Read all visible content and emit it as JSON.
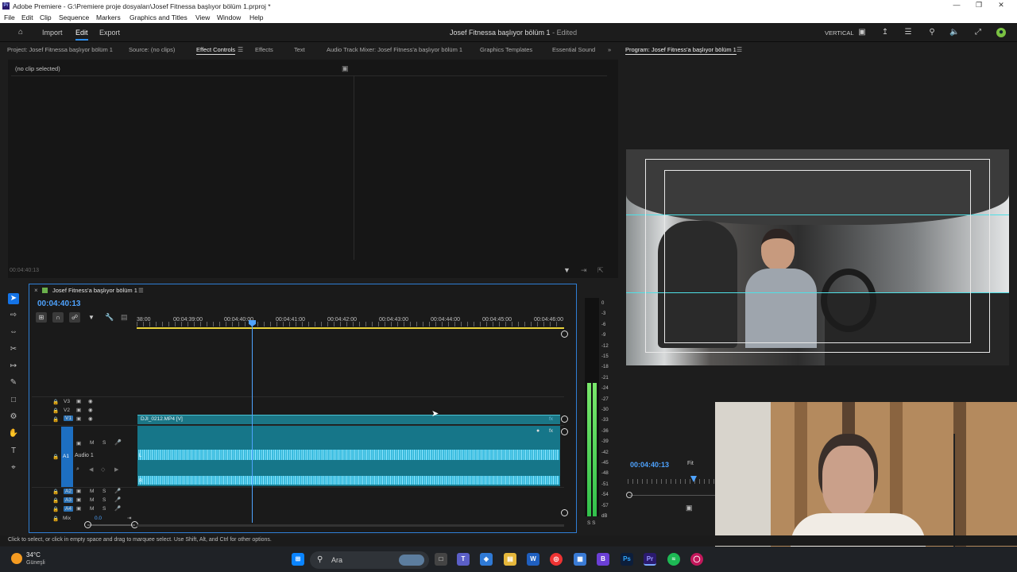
{
  "titlebar": {
    "title": "Adobe Premiere - G:\\Premiere proje dosyaları\\Josef Fitnessa başlıyor bölüm 1.prproj *",
    "app_icon": "Pr"
  },
  "menu": [
    "File",
    "Edit",
    "Clip",
    "Sequence",
    "Markers",
    "Graphics and Titles",
    "View",
    "Window",
    "Help"
  ],
  "header": {
    "nav": [
      "Import",
      "Edit",
      "Export"
    ],
    "active": "Edit",
    "project_title": "Josef Fitnessa başlıyor bölüm 1",
    "project_state": "- Edited",
    "workspace": "VERTICAL"
  },
  "left_tabs": [
    "Project: Josef Fitnessa başlıyor bölüm 1",
    "Source: (no clips)",
    "Effect Controls",
    "Effects",
    "Text",
    "Audio Track Mixer: Josef Fitness'a başlıyor bölüm 1",
    "Graphics Templates",
    "Essential Sound"
  ],
  "left_tab_active": "Effect Controls",
  "effect_controls": {
    "empty_msg": "(no clip selected)",
    "timecode": "00:04:40:13"
  },
  "timeline": {
    "sequence_name": "Josef Fitness'a başlıyor bölüm 1",
    "timecode": "00:04:40:13",
    "ruler": [
      "38:00",
      "00:04:39:00",
      "00:04:40:00",
      "00:04:41:00",
      "00:04:42:00",
      "00:04:43:00",
      "00:04:44:00",
      "00:04:45:00",
      "00:04:46:00"
    ],
    "tracks_video": [
      "V3",
      "V2",
      "V1"
    ],
    "tracks_audio": [
      "A1",
      "A2",
      "A3",
      "A4"
    ],
    "audio1_name": "Audio 1",
    "mix_label": "Mix",
    "mix_value": "0.0",
    "clip_name": "DJI_0212.MP4 [V]",
    "track_btn_m": "M",
    "track_btn_s": "S",
    "lane_l": "L",
    "lane_r": "R",
    "clip_fx": "fx"
  },
  "meter_labels": [
    "0",
    "-3",
    "-6",
    "-9",
    "-12",
    "-15",
    "-18",
    "-21",
    "-24",
    "-27",
    "-30",
    "-33",
    "-36",
    "-39",
    "-42",
    "-45",
    "-48",
    "-51",
    "-54",
    "-57",
    "dB"
  ],
  "meter_solo": "S S",
  "program": {
    "title": "Program: Josef Fitness'a başlıyor bölüm 1",
    "timecode": "00:04:40:13",
    "fit": "Fit"
  },
  "status": "Click to select, or click in empty space and drag to marquee select. Use Shift, Alt, and Ctrl for other options.",
  "taskbar": {
    "weather_temp": "34°C",
    "weather_desc": "Güneşli",
    "search": "Ara"
  },
  "colors": {
    "accent": "#1473e6",
    "timecode": "#4ea3ff",
    "clip": "#1b7686",
    "waveform": "#6ad6f0"
  }
}
